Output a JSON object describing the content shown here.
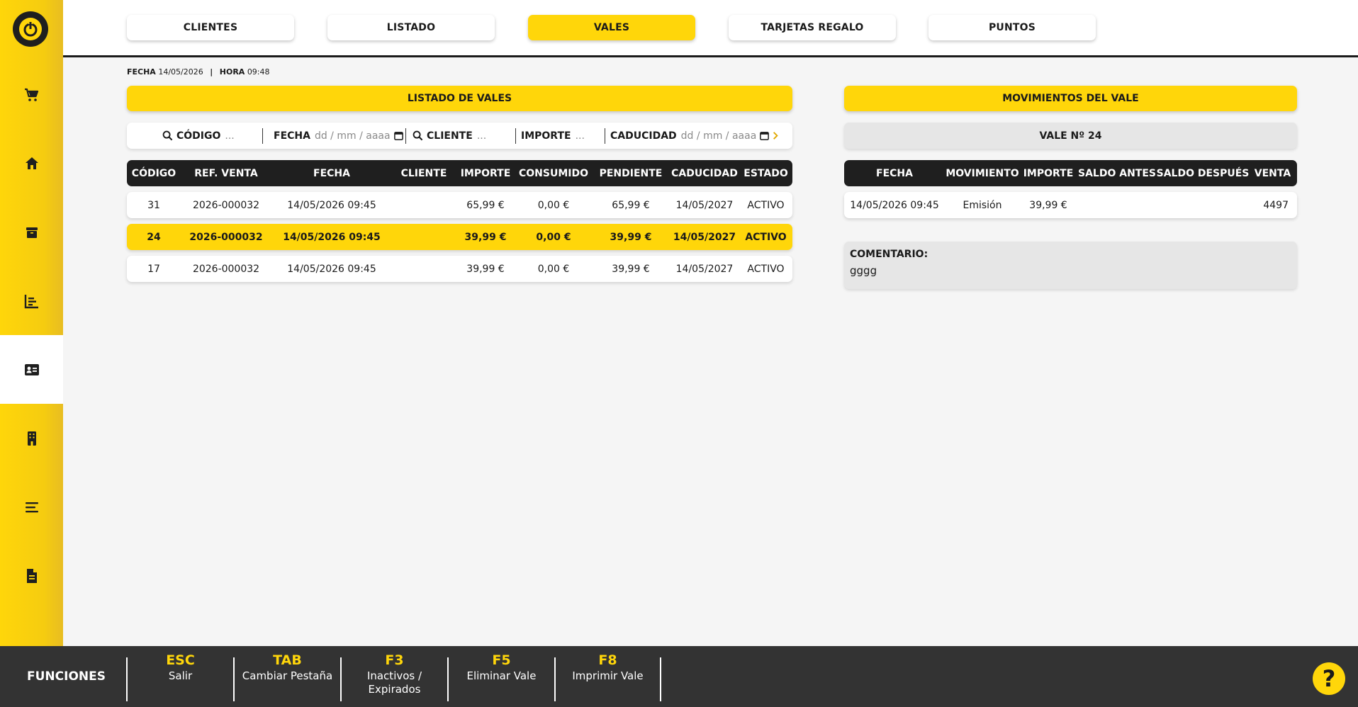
{
  "tabs": [
    {
      "label": "CLIENTES"
    },
    {
      "label": "LISTADO"
    },
    {
      "label": "VALES"
    },
    {
      "label": "TARJETAS REGALO"
    },
    {
      "label": "PUNTOS"
    }
  ],
  "active_tab": "VALES",
  "meta": {
    "fecha_label": "FECHA",
    "fecha_value": "14/05/2026",
    "separator": "|",
    "hora_label": "HORA",
    "hora_value": "09:48"
  },
  "left_panel": {
    "title": "LISTADO DE VALES",
    "filters": {
      "codigo_label": "CÓDIGO",
      "codigo_placeholder": "...",
      "fecha_label": "FECHA",
      "fecha_placeholder": "dd / mm / aaaa",
      "cliente_label": "CLIENTE",
      "cliente_placeholder": "...",
      "importe_label": "IMPORTE",
      "importe_placeholder": "...",
      "caducidad_label": "CADUCIDAD",
      "caducidad_placeholder": "dd / mm / aaaa"
    },
    "columns": [
      "CÓDIGO",
      "REF. VENTA",
      "FECHA",
      "CLIENTE",
      "IMPORTE",
      "CONSUMIDO",
      "PENDIENTE",
      "CADUCIDAD",
      "ESTADO"
    ],
    "rows": [
      [
        "31",
        "2026-000032",
        "14/05/2026 09:45",
        "",
        "65,99 €",
        "0,00 €",
        "65,99 €",
        "14/05/2027",
        "ACTIVO"
      ],
      [
        "24",
        "2026-000032",
        "14/05/2026 09:45",
        "",
        "39,99 €",
        "0,00 €",
        "39,99 €",
        "14/05/2027",
        "ACTIVO"
      ],
      [
        "17",
        "2026-000032",
        "14/05/2026 09:45",
        "",
        "39,99 €",
        "0,00 €",
        "39,99 €",
        "14/05/2027",
        "ACTIVO"
      ]
    ],
    "selected_row_index": 1
  },
  "right_panel": {
    "title": "MOVIMIENTOS DEL VALE",
    "vale_title": "VALE Nº 24",
    "columns": [
      "FECHA",
      "MOVIMIENTO",
      "IMPORTE",
      "SALDO ANTES",
      "SALDO DESPUÉS",
      "VENTA"
    ],
    "rows": [
      [
        "14/05/2026 09:45",
        "Emisión",
        "39,99 €",
        "",
        "",
        "4497"
      ]
    ],
    "comment_label": "COMENTARIO:",
    "comment_value": "gggg"
  },
  "footer": {
    "title": "FUNCIONES",
    "keys": [
      {
        "key": "ESC",
        "desc": "Salir"
      },
      {
        "key": "TAB",
        "desc": "Cambiar Pestaña"
      },
      {
        "key": "F3",
        "desc": "Inactivos / Expirados"
      },
      {
        "key": "F5",
        "desc": "Eliminar Vale"
      },
      {
        "key": "F8",
        "desc": "Imprimir Vale"
      }
    ],
    "help_symbol": "?"
  },
  "sidebar_icons": [
    "cart-icon",
    "home-icon",
    "box-icon",
    "chart-icon",
    "contact-card-icon",
    "building-icon",
    "list-icon",
    "document-icon"
  ],
  "colors": {
    "accent": "#ffd60a",
    "dark": "#1f1f1f",
    "footer": "#333333",
    "background": "#f5f5f5"
  }
}
